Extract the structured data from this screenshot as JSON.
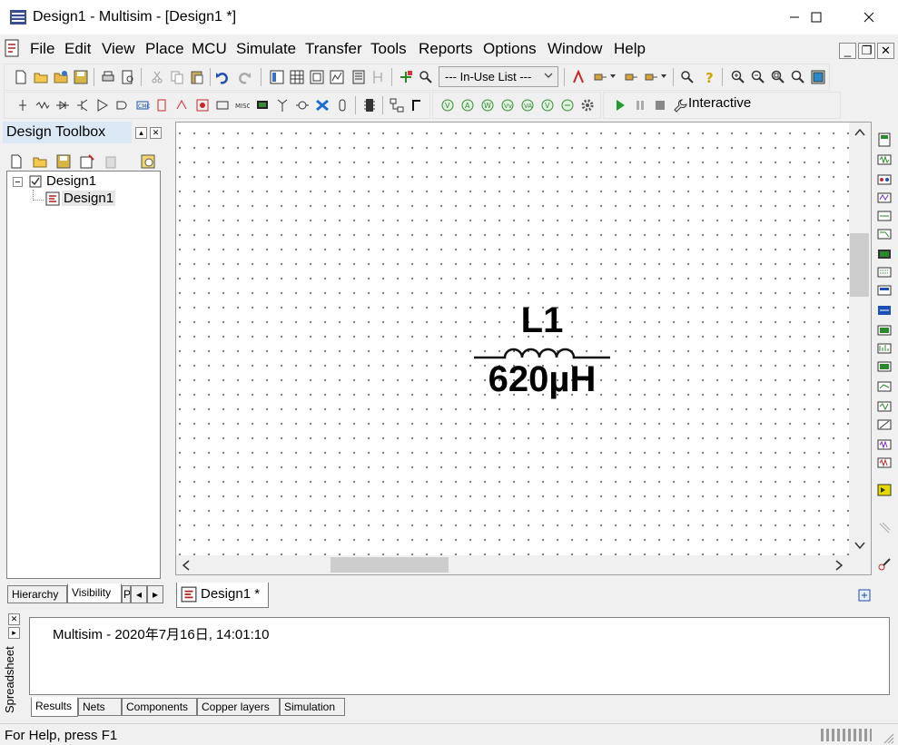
{
  "window": {
    "title": "Design1 - Multisim - [Design1 *]",
    "controls": {
      "minimize": "—",
      "maximize": "☐",
      "close": "✕"
    }
  },
  "menu": {
    "items": [
      "File",
      "Edit",
      "View",
      "Place",
      "MCU",
      "Simulate",
      "Transfer",
      "Tools",
      "Reports",
      "Options",
      "Window",
      "Help"
    ],
    "mdi_controls": {
      "minimize": "_",
      "restore": "❐",
      "close": "✕"
    }
  },
  "toolbar": {
    "inuse_list": "--- In-Use List ---",
    "interactive": "Interactive"
  },
  "toolbox": {
    "title": "Design Toolbox",
    "tree": {
      "root": "Design1",
      "child": "Design1"
    },
    "tabs": [
      "Hierarchy",
      "Visibility",
      "P"
    ]
  },
  "canvas": {
    "component": {
      "ref": "L1",
      "value": "620µH",
      "type": "inductor"
    },
    "tab_label": "Design1 *"
  },
  "spreadsheet": {
    "label": "Spreadsheet",
    "message": "Multisim  -  2020年7月16日, 14:01:10",
    "tabs": [
      "Results",
      "Nets",
      "Components",
      "Copper layers",
      "Simulation"
    ]
  },
  "status": {
    "help": "For Help, press F1"
  },
  "colors": {
    "selection": "#dbe9f6",
    "canvas": "#ffffff",
    "chrome": "#f0f0f0",
    "symbol": "#111111"
  }
}
